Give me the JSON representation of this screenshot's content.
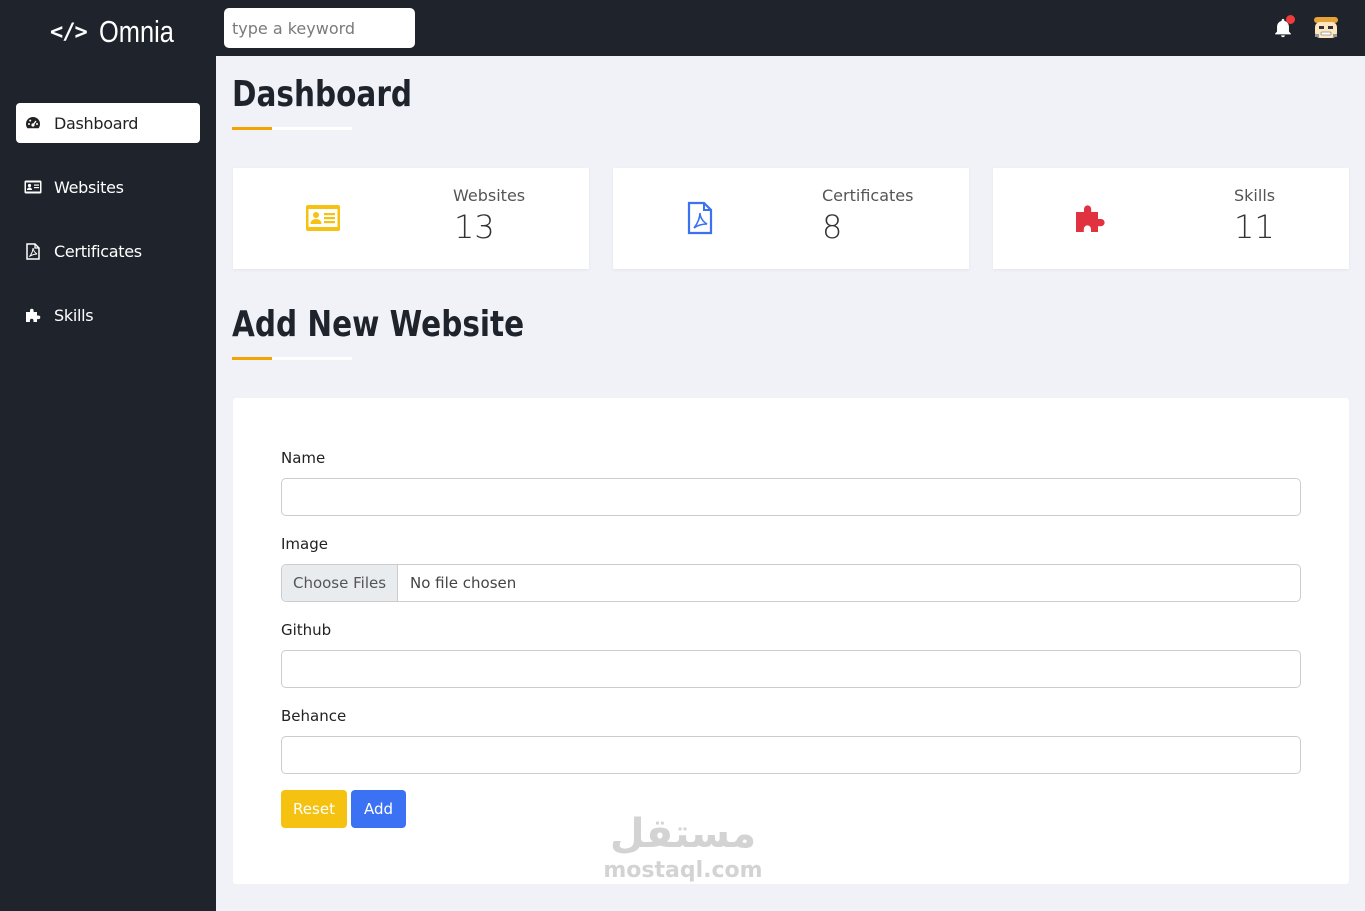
{
  "brand": {
    "icon_text": "</>",
    "name": "Omnia"
  },
  "search": {
    "placeholder": "type a keyword",
    "value": ""
  },
  "header": {
    "notification_icon": "bell-icon",
    "has_unread": true,
    "avatar_icon": "avatar-icon"
  },
  "sidebar": {
    "items": [
      {
        "label": "Dashboard",
        "icon": "gauge-icon",
        "active": true
      },
      {
        "label": "Websites",
        "icon": "id-card-icon",
        "active": false
      },
      {
        "label": "Certificates",
        "icon": "file-pdf-icon",
        "active": false
      },
      {
        "label": "Skills",
        "icon": "puzzle-icon",
        "active": false
      }
    ]
  },
  "dashboard": {
    "title": "Dashboard",
    "stats": [
      {
        "label": "Websites",
        "value": "13",
        "icon": "id-card-icon",
        "color": "#f5c211"
      },
      {
        "label": "Certificates",
        "value": "8",
        "icon": "file-pdf-icon",
        "color": "#3b71f3"
      },
      {
        "label": "Skills",
        "value": "11",
        "icon": "puzzle-icon",
        "color": "#e0323f"
      }
    ]
  },
  "form": {
    "title": "Add New Website",
    "name_label": "Name",
    "image_label": "Image",
    "file_button": "Choose Files",
    "file_status": "No file chosen",
    "github_label": "Github",
    "behance_label": "Behance",
    "reset_label": "Reset",
    "add_label": "Add"
  },
  "watermark": {
    "arabic": "مستقل",
    "latin": "mostaql.com"
  },
  "colors": {
    "sidebar_bg": "#1f232b",
    "accent_underline": "#f4a300",
    "content_bg": "#f0f2f7"
  }
}
